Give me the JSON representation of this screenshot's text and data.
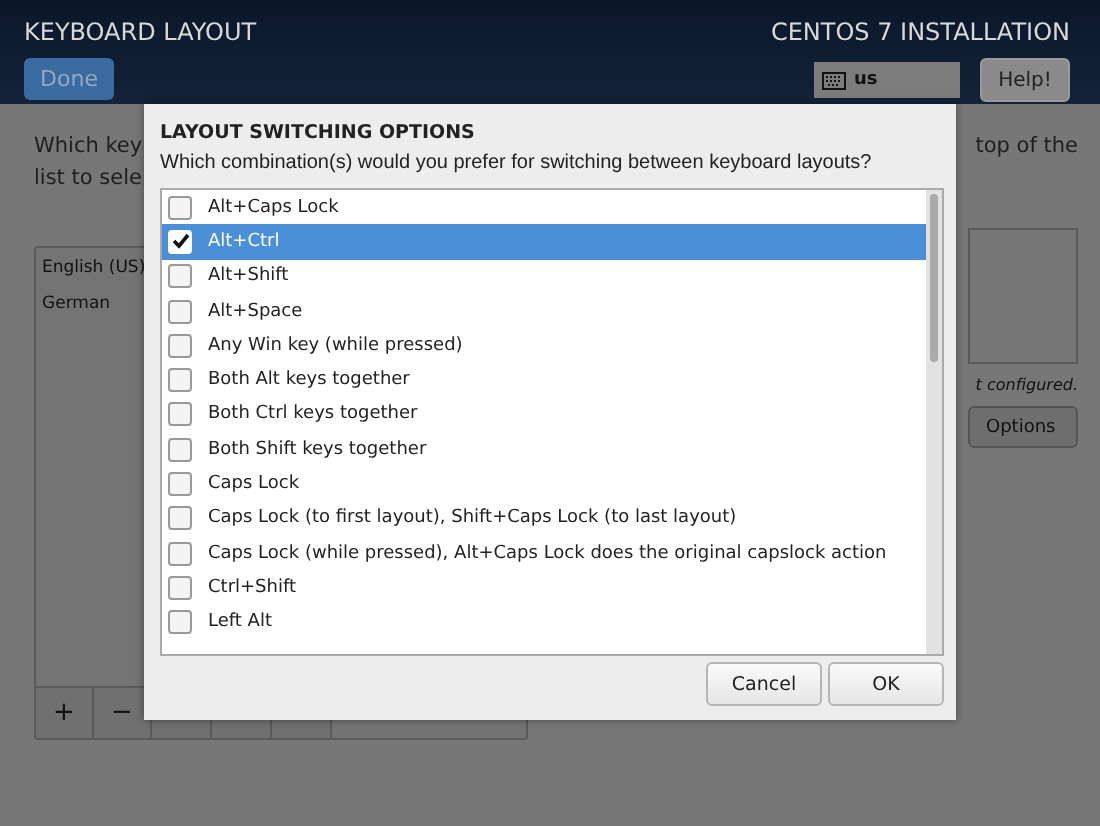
{
  "header": {
    "title": "KEYBOARD LAYOUT",
    "done_button": "Done",
    "product": "CENTOS 7 INSTALLATION",
    "keyboard_indicator": "us",
    "help_button": "Help!"
  },
  "background": {
    "prompt_start": [
      "Which key",
      "list to sele"
    ],
    "prompt_end": "top of the",
    "layouts": [
      "English (US)",
      "German"
    ],
    "toolbar": [
      "+",
      "−"
    ],
    "status": "t configured.",
    "options_button": "Options"
  },
  "dialog": {
    "title": "LAYOUT SWITCHING OPTIONS",
    "question": "Which combination(s) would you prefer for switching between keyboard layouts?",
    "options": [
      {
        "label": "Alt+Caps Lock",
        "checked": false,
        "selected": false
      },
      {
        "label": "Alt+Ctrl",
        "checked": true,
        "selected": true
      },
      {
        "label": "Alt+Shift",
        "checked": false,
        "selected": false
      },
      {
        "label": "Alt+Space",
        "checked": false,
        "selected": false
      },
      {
        "label": "Any Win key (while pressed)",
        "checked": false,
        "selected": false
      },
      {
        "label": "Both Alt keys together",
        "checked": false,
        "selected": false
      },
      {
        "label": "Both Ctrl keys together",
        "checked": false,
        "selected": false
      },
      {
        "label": "Both Shift keys together",
        "checked": false,
        "selected": false
      },
      {
        "label": "Caps Lock",
        "checked": false,
        "selected": false
      },
      {
        "label": "Caps Lock (to first layout), Shift+Caps Lock (to last layout)",
        "checked": false,
        "selected": false
      },
      {
        "label": "Caps Lock (while pressed), Alt+Caps Lock does the original capslock action",
        "checked": false,
        "selected": false
      },
      {
        "label": "Ctrl+Shift",
        "checked": false,
        "selected": false
      },
      {
        "label": "Left Alt",
        "checked": false,
        "selected": false
      }
    ],
    "buttons": [
      "Cancel",
      "OK"
    ]
  }
}
